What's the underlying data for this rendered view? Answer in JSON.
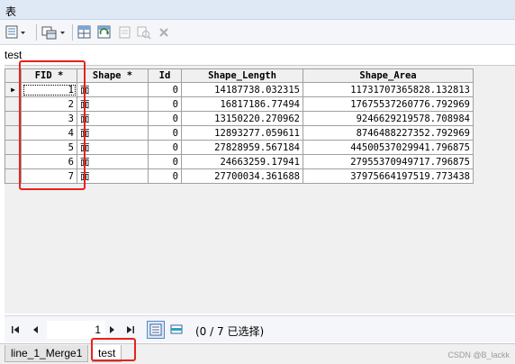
{
  "window": {
    "title": "表"
  },
  "toolbar": {
    "items": [
      {
        "name": "table-options-button"
      },
      {
        "name": "related-tables-button"
      },
      {
        "name": "select-by-attributes-button"
      },
      {
        "name": "switch-selection-button"
      },
      {
        "name": "clear-selection-button"
      },
      {
        "name": "zoom-to-selected-button"
      },
      {
        "name": "delete-selected-button"
      }
    ]
  },
  "table": {
    "name": "test",
    "columns": [
      "FID *",
      "Shape *",
      "Id",
      "Shape_Length",
      "Shape_Area"
    ],
    "rows": [
      {
        "fid": "1",
        "shape": "面",
        "id": "0",
        "length": "14187738.032315",
        "area": "11731707365828.132813"
      },
      {
        "fid": "2",
        "shape": "面",
        "id": "0",
        "length": "16817186.77494",
        "area": "17675537260776.792969"
      },
      {
        "fid": "3",
        "shape": "面",
        "id": "0",
        "length": "13150220.270962",
        "area": "9246629219578.708984"
      },
      {
        "fid": "4",
        "shape": "面",
        "id": "0",
        "length": "12893277.059611",
        "area": "8746488227352.792969"
      },
      {
        "fid": "5",
        "shape": "面",
        "id": "0",
        "length": "27828959.567184",
        "area": "44500537029941.796875"
      },
      {
        "fid": "6",
        "shape": "面",
        "id": "0",
        "length": "24663259.17941",
        "area": "27955370949717.796875"
      },
      {
        "fid": "7",
        "shape": "面",
        "id": "0",
        "length": "27700034.361688",
        "area": "37975664197519.773438"
      }
    ]
  },
  "navigation": {
    "current_record": "1",
    "status": "(0 / 7 已选择)"
  },
  "tabs": [
    {
      "label": "line_1_Merge1",
      "active": false
    },
    {
      "label": "test",
      "active": true
    }
  ],
  "watermark": "CSDN @B_lackk",
  "colors": {
    "highlight_box": "#e8221c",
    "titlebar": "#dfe9f5"
  }
}
